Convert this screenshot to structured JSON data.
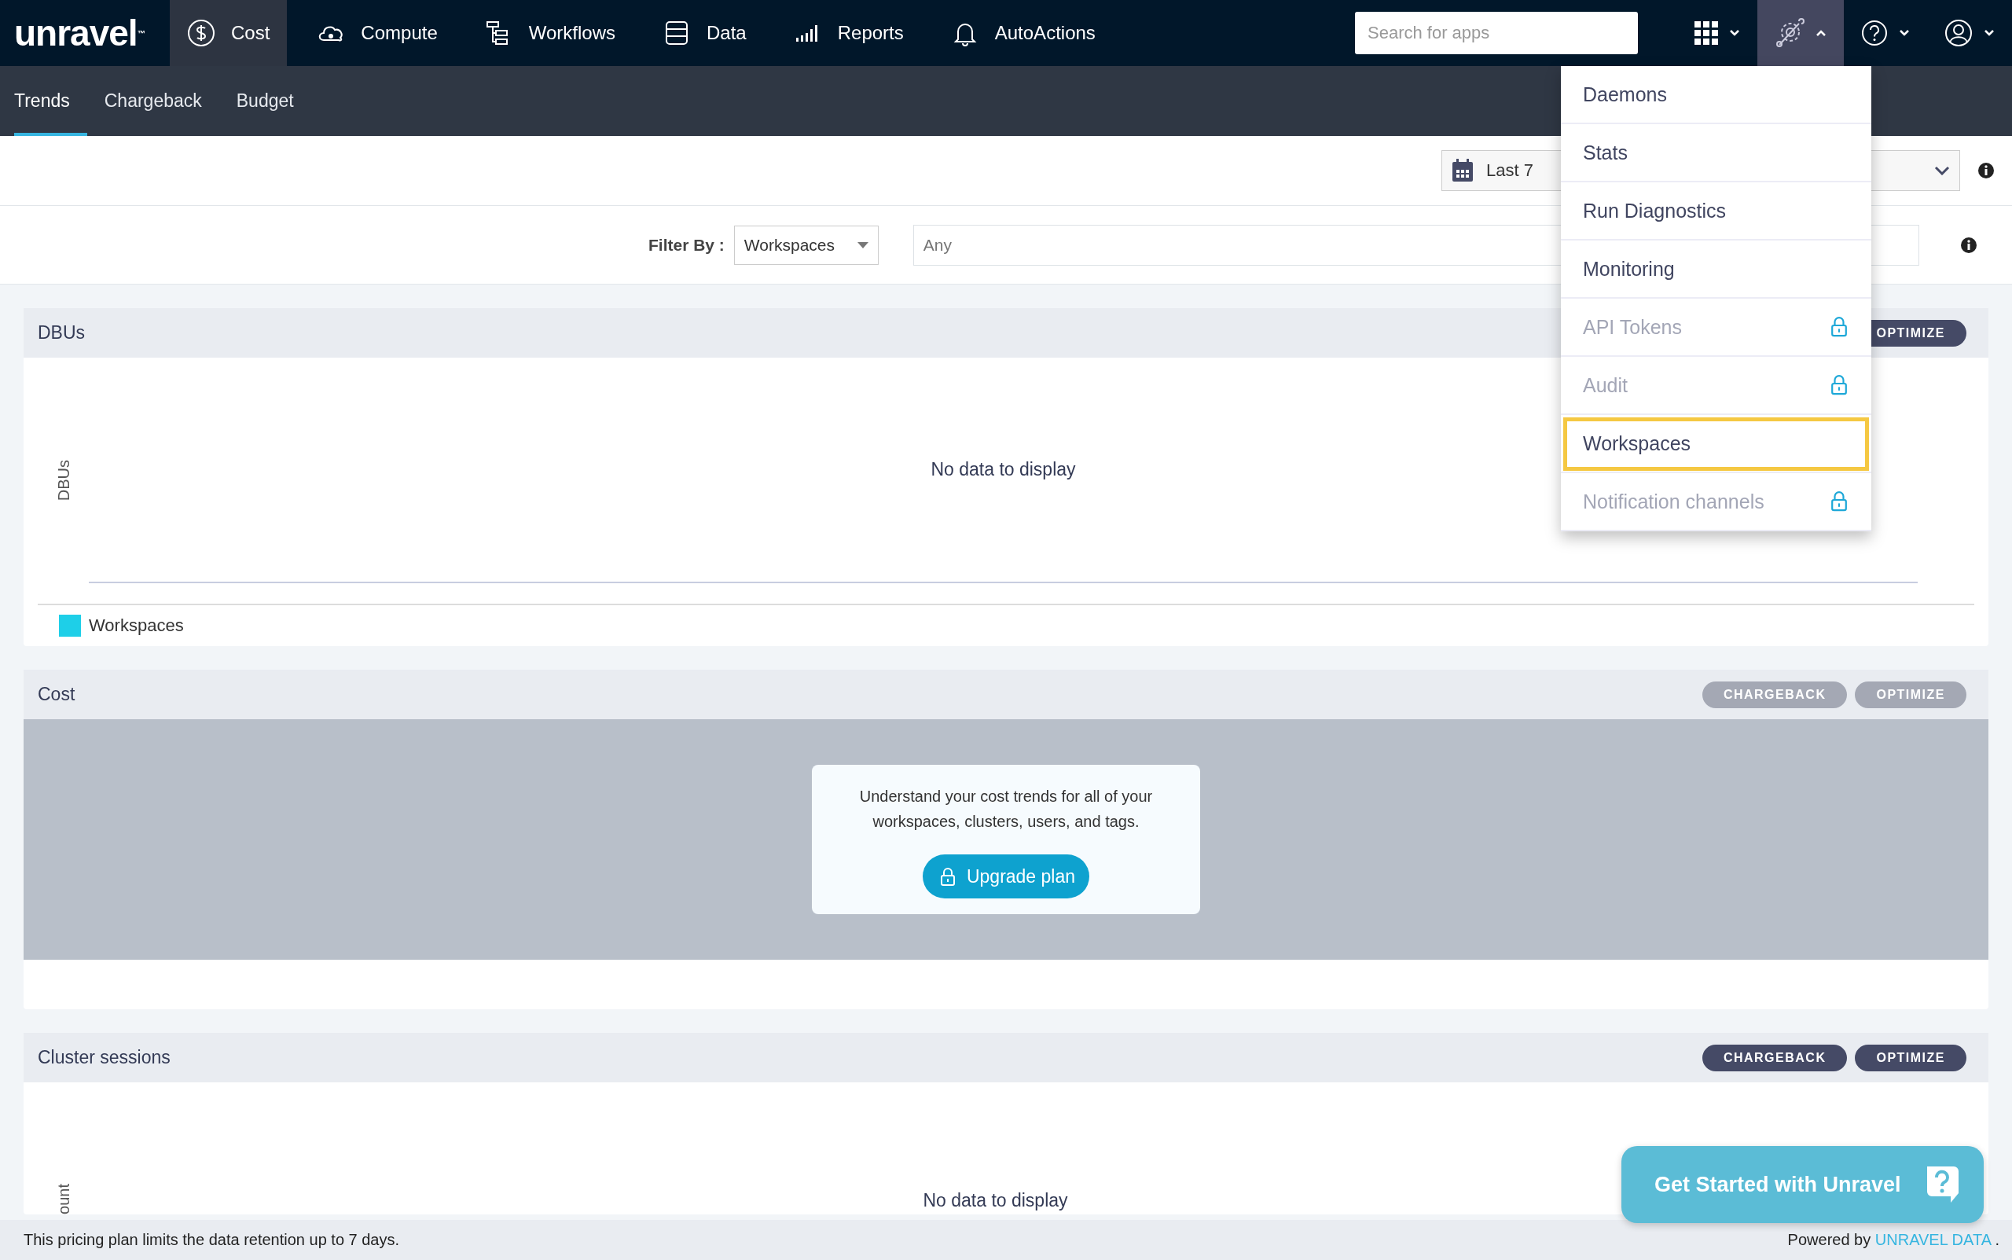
{
  "nav": {
    "logo": "unravel",
    "logo_mark": "™",
    "items": [
      {
        "label": "Cost",
        "selected": true
      },
      {
        "label": "Compute",
        "selected": false
      },
      {
        "label": "Workflows",
        "selected": false
      },
      {
        "label": "Data",
        "selected": false
      },
      {
        "label": "Reports",
        "selected": false
      },
      {
        "label": "AutoActions",
        "selected": false
      }
    ],
    "search": {
      "placeholder": "Search for apps"
    },
    "tools": [
      {
        "expanded": false
      },
      {
        "expanded": true
      },
      {
        "expanded": false
      },
      {
        "expanded": false
      }
    ]
  },
  "subtabs": [
    {
      "label": "Trends",
      "selected": true
    },
    {
      "label": "Chargeback",
      "selected": false
    },
    {
      "label": "Budget",
      "selected": false
    }
  ],
  "date_range": {
    "value": "Last 7"
  },
  "filter": {
    "label": "Filter By :",
    "select": "Workspaces",
    "placeholder": "Any"
  },
  "panels": [
    {
      "kind": "chart",
      "title": "DBUs",
      "buttons": [
        {
          "label": "OPTIMIZE",
          "disabled": false
        }
      ],
      "y_label": "DBUs",
      "empty_text": "No data to display",
      "legend": [
        {
          "label": "Workspaces",
          "color": "#1ecfe8"
        }
      ]
    },
    {
      "kind": "locked",
      "title": "Cost",
      "buttons": [
        {
          "label": "CHARGEBACK",
          "disabled": true
        },
        {
          "label": "OPTIMIZE",
          "disabled": true
        }
      ],
      "message": "Understand your cost trends for all of your workspaces, clusters, users, and tags.",
      "upgrade_button": "Upgrade plan"
    },
    {
      "kind": "chart",
      "title": "Cluster sessions",
      "buttons": [
        {
          "label": "CHARGEBACK",
          "disabled": false
        },
        {
          "label": "OPTIMIZE",
          "disabled": false
        }
      ],
      "y_label": "ount",
      "empty_text": "No data to display"
    }
  ],
  "menu": [
    {
      "label": "Daemons",
      "locked": false,
      "selected": false
    },
    {
      "label": "Stats",
      "locked": false,
      "selected": false
    },
    {
      "label": "Run Diagnostics",
      "locked": false,
      "selected": false
    },
    {
      "label": "Monitoring",
      "locked": false,
      "selected": false
    },
    {
      "label": "API Tokens",
      "locked": true,
      "selected": false
    },
    {
      "label": "Audit",
      "locked": true,
      "selected": false
    },
    {
      "label": "Workspaces",
      "locked": false,
      "selected": true
    },
    {
      "label": "Notification channels",
      "locked": true,
      "selected": false
    }
  ],
  "footer": {
    "note": "This pricing plan limits the data retention up to 7 days.",
    "powered_by": "Powered by",
    "link": "UNRAVEL DATA",
    "trailing": "."
  },
  "help_button": {
    "label": "Get Started with Unravel"
  }
}
